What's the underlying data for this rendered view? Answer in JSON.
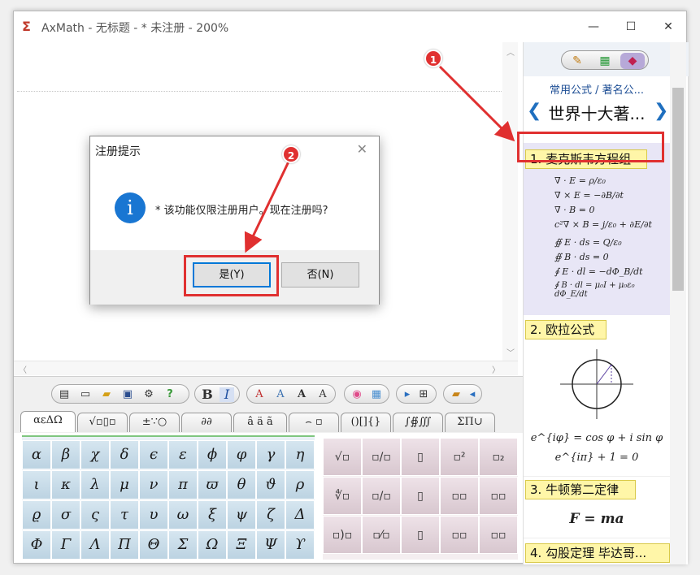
{
  "window": {
    "title": "AxMath - 无标题 - * 未注册 - 200%",
    "minimize": "—",
    "maximize": "☐",
    "close": "✕"
  },
  "toolbar": {
    "bold": "B",
    "italic": "I"
  },
  "tabs": [
    "αεΔΩ",
    "√▫▯▫",
    "±∵○",
    "∂∂",
    "â ä ã",
    "⌢ ▫",
    "()[]{}",
    "∫∯∭",
    "ΣΠ∪"
  ],
  "greek": [
    [
      "α",
      "β",
      "χ",
      "δ",
      "ϵ",
      "ε",
      "ϕ",
      "φ",
      "γ",
      "η"
    ],
    [
      "ι",
      "κ",
      "λ",
      "μ",
      "ν",
      "π",
      "ϖ",
      "θ",
      "ϑ",
      "ρ"
    ],
    [
      "ϱ",
      "σ",
      "ς",
      "τ",
      "υ",
      "ω",
      "ξ",
      "ψ",
      "ζ",
      "Δ"
    ],
    [
      "Φ",
      "Γ",
      "Λ",
      "Π",
      "Θ",
      "Σ",
      "Ω",
      "Ξ",
      "Ψ",
      "ϒ"
    ]
  ],
  "templates": [
    "√▫",
    "▫/▫",
    "▯",
    "▫²",
    "▫₂",
    "∜▫",
    "▫/▫",
    "▯",
    "▫▫",
    "▫▫",
    "▫)▫",
    "▫⁄▫",
    "▯",
    "▫▫",
    "▫▫"
  ],
  "right_panel": {
    "breadcrumb": "常用公式 / 著名公...",
    "section_title": "世界十大著...",
    "prev": "❮",
    "next": "❯",
    "items": [
      {
        "label": "1. 麦克斯韦方程组"
      },
      {
        "label": "2. 欧拉公式"
      },
      {
        "label": "3. 牛顿第二定律"
      },
      {
        "label": "4. 勾股定理 毕达哥..."
      }
    ],
    "euler_line1": "e^{iφ} = cos φ + i sin φ",
    "euler_line2": "e^{iπ} + 1 = 0",
    "newton": "F = ma",
    "maxwell_lines": [
      "∇ · E = ρ/ε₀",
      "∇ × E = −∂B/∂t",
      "∇ · B = 0",
      "c²∇ × B = j/ε₀ + ∂E/∂t",
      "∯ E · ds = Q/ε₀",
      "∯ B · ds = 0",
      "∮ E · dl = −dΦ_B/dt",
      "∮ B · dl = μ₀I + μ₀ε₀ dΦ_E/dt"
    ]
  },
  "dialog": {
    "title": "注册提示",
    "close": "✕",
    "message": "* 该功能仅限注册用户。现在注册吗?",
    "info_glyph": "i",
    "yes": "是(Y)",
    "no": "否(N)"
  },
  "annotations": {
    "badge1": "1",
    "badge2": "2",
    "color": "#e03030"
  }
}
